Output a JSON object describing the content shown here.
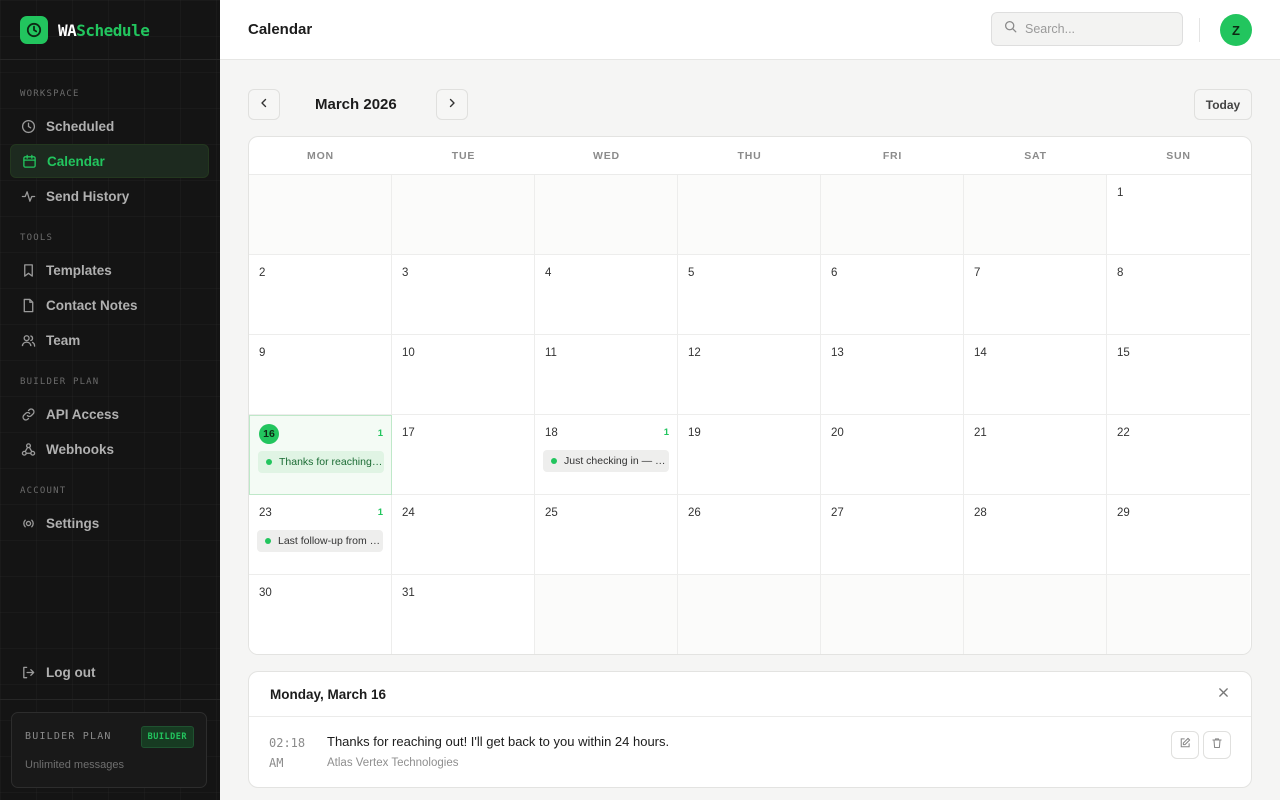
{
  "app": {
    "brand_prefix": "WA",
    "brand_suffix": "Schedule"
  },
  "sidebar": {
    "sections": {
      "workspace": "WORKSPACE",
      "tools": "TOOLS",
      "builder_plan": "BUILDER PLAN",
      "account": "ACCOUNT"
    },
    "items": {
      "scheduled": "Scheduled",
      "calendar": "Calendar",
      "send_history": "Send History",
      "templates": "Templates",
      "contact_notes": "Contact Notes",
      "team": "Team",
      "api_access": "API Access",
      "webhooks": "Webhooks",
      "settings": "Settings",
      "logout": "Log out"
    },
    "active_item": "calendar",
    "plan": {
      "title": "BUILDER PLAN",
      "badge": "BUILDER",
      "subtitle": "Unlimited messages"
    }
  },
  "header": {
    "title": "Calendar",
    "search_placeholder": "Search...",
    "avatar_initial": "Z"
  },
  "calendar": {
    "month_label": "March 2026",
    "today_label": "Today",
    "weekdays": [
      "MON",
      "TUE",
      "WED",
      "THU",
      "FRI",
      "SAT",
      "SUN"
    ],
    "weeks": [
      [
        "",
        "",
        "",
        "",
        "",
        "",
        "1"
      ],
      [
        "2",
        "3",
        "4",
        "5",
        "6",
        "7",
        "8"
      ],
      [
        "9",
        "10",
        "11",
        "12",
        "13",
        "14",
        "15"
      ],
      [
        "16",
        "17",
        "18",
        "19",
        "20",
        "21",
        "22"
      ],
      [
        "23",
        "24",
        "25",
        "26",
        "27",
        "28",
        "29"
      ],
      [
        "30",
        "31",
        "",
        "",
        "",
        "",
        ""
      ]
    ],
    "selected_day": "16",
    "events": {
      "16": {
        "count": "1",
        "preview": "Thanks for reaching out! I'll get back to you within 24 hours."
      },
      "18": {
        "count": "1",
        "preview": "Just checking in — how is everything going?"
      },
      "23": {
        "count": "1",
        "preview": "Last follow-up from our side this week."
      }
    }
  },
  "detail": {
    "title": "Monday, March 16",
    "messages": [
      {
        "time": "02:18",
        "ampm": "AM",
        "text": "Thanks for reaching out! I'll get back to you within 24 hours.",
        "contact": "Atlas Vertex Technologies"
      }
    ]
  },
  "colors": {
    "accent": "#22c55e",
    "sidebar_bg": "#141414",
    "page_bg": "#f5f5f4"
  }
}
